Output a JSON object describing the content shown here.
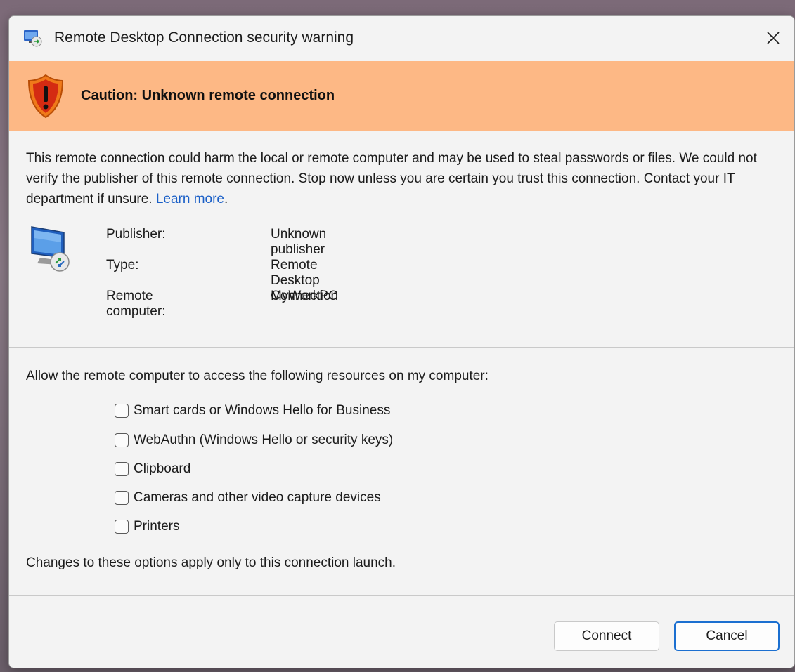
{
  "window": {
    "title": "Remote Desktop Connection security warning",
    "icon": "remote-desktop-icon",
    "close_icon": "close-icon"
  },
  "banner": {
    "icon": "warning-shield-icon",
    "text": "Caution: Unknown remote connection",
    "background_color": "#fdb885"
  },
  "warning": {
    "text": "This remote connection could harm the local or remote computer and may be used to steal passwords or files. We could not verify the publisher of this remote connection. Stop now unless you are certain you trust this connection. Contact your IT department if unsure.",
    "link_label": "Learn more",
    "trailing": "."
  },
  "details": {
    "icon": "remote-computer-icon",
    "rows": [
      {
        "label": "Publisher:",
        "value": "Unknown publisher"
      },
      {
        "label": "Type:",
        "value": "Remote Desktop Connection"
      },
      {
        "label": "Remote computer:",
        "value": "MyWorkPC"
      }
    ]
  },
  "resources": {
    "prompt": "Allow the remote computer to access the following resources on my computer:",
    "options": [
      {
        "label": "Smart cards or Windows Hello for Business",
        "checked": false
      },
      {
        "label": "WebAuthn (Windows Hello or security keys)",
        "checked": false
      },
      {
        "label": "Clipboard",
        "checked": false
      },
      {
        "label": "Cameras and other video capture devices",
        "checked": false
      },
      {
        "label": "Printers",
        "checked": false
      }
    ],
    "note": "Changes to these options apply only to this connection launch."
  },
  "buttons": {
    "connect_label": "Connect",
    "cancel_label": "Cancel",
    "accent_color": "#1b6fd0"
  }
}
